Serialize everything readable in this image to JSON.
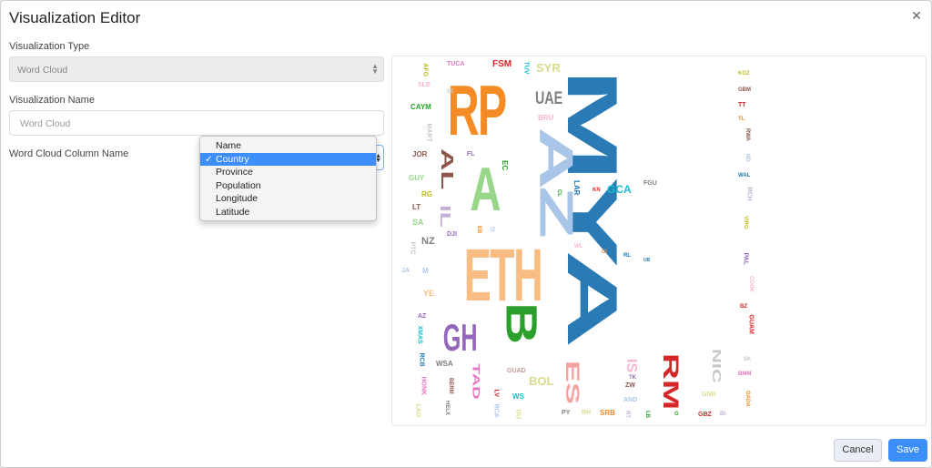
{
  "dialog": {
    "title": "Visualization Editor"
  },
  "form": {
    "type_label": "Visualization Type",
    "type_value": "Word Cloud",
    "name_label": "Visualization Name",
    "name_placeholder": "Word Cloud",
    "column_label": "Word Cloud Column Name"
  },
  "dropdown": {
    "options": [
      "Name",
      "Country",
      "Province",
      "Population",
      "Longitude",
      "Latitude"
    ],
    "selected": "Country",
    "check": "✓"
  },
  "cloud_words": [
    "MYA",
    "AZ",
    "RP",
    "ETH",
    "A",
    "B",
    "GH",
    "AL",
    "IL",
    "UAE",
    "SYR",
    "FSM",
    "TUCA",
    "AFG",
    "SLB",
    "TUV",
    "CAYM",
    "BRU",
    "MART",
    "JOR",
    "FL",
    "EC",
    "GUY",
    "RG",
    "LT",
    "SA",
    "DJI",
    "NZ",
    "PTC",
    "JA",
    "M",
    "YE",
    "AZ",
    "XMAS",
    "RCB",
    "HONK",
    "LAO",
    "WSA",
    "BERM",
    "HELX",
    "TAD",
    "LV",
    "RCA",
    "WS",
    "GUAD",
    "BOL",
    "GU",
    "SRB",
    "PY",
    "ES",
    "ZW",
    "AND",
    "IS",
    "RM",
    "NIC",
    "GNB",
    "GBZ",
    "RT",
    "LB",
    "KGZ",
    "GBM",
    "TT",
    "TL",
    "RWA",
    "ND",
    "WAL",
    "RCH",
    "VIRG",
    "PAL",
    "COOK",
    "BZ",
    "GUAM",
    "SK",
    "BMM",
    "GADA",
    "LAR",
    "KN",
    "GCA",
    "FGU",
    "CL",
    "CI",
    "WL",
    "RL",
    "UB",
    "EB",
    "TK",
    "IZ",
    "G",
    "BI",
    "RH",
    "SE"
  ],
  "buttons": {
    "cancel": "Cancel",
    "save": "Save"
  },
  "icons": {
    "close": "close-icon",
    "select_arrows": "updown-arrows-icon",
    "check": "check-icon"
  },
  "colors": {
    "accent": "#3d8ef8",
    "primary_word": "#2a7ab5"
  }
}
